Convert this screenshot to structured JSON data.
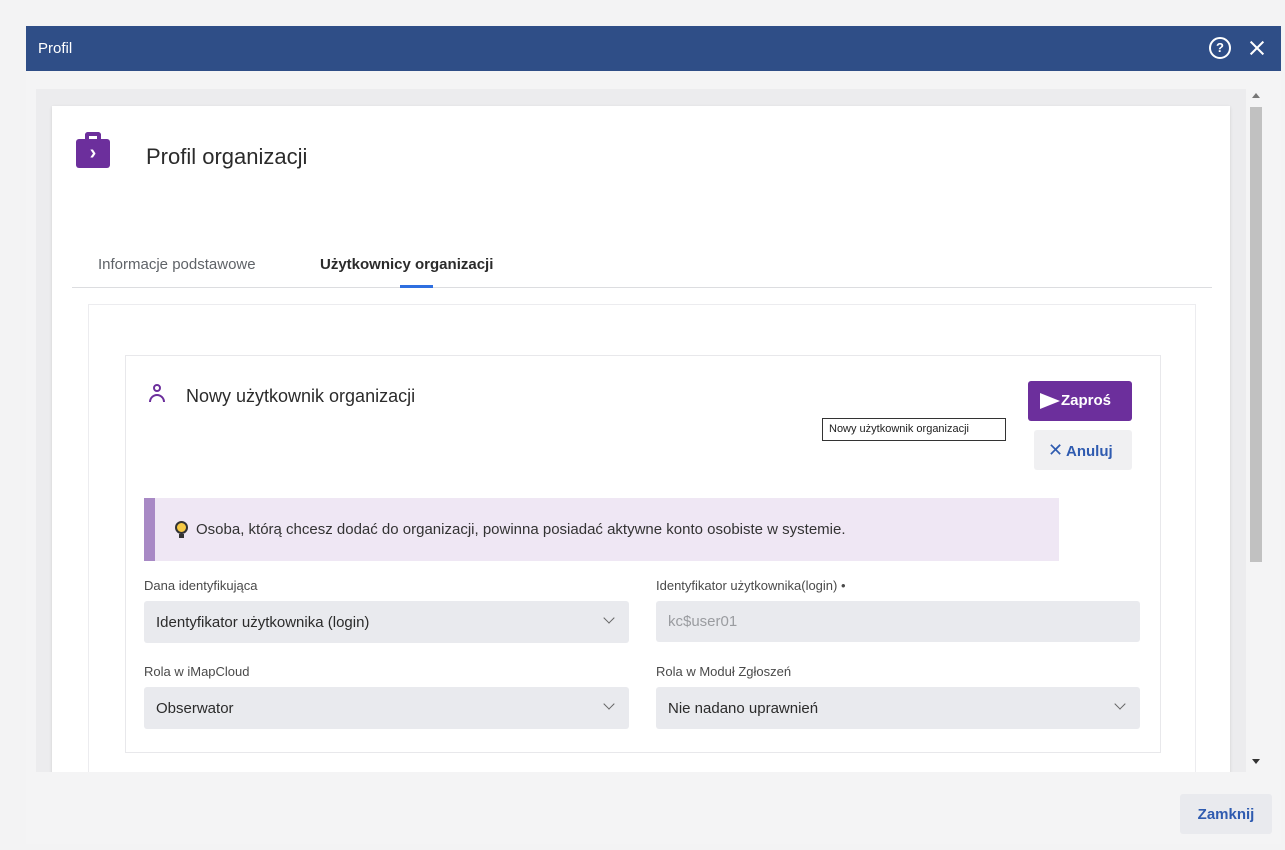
{
  "window": {
    "title": "Profil"
  },
  "card": {
    "title": "Profil organizacji"
  },
  "tabs": [
    {
      "label": "Informacje podstawowe",
      "active": false
    },
    {
      "label": "Użytkownicy organizacji",
      "active": true
    }
  ],
  "section": {
    "title": "Nowy użytkownik organizacji",
    "invite_label": "Zaproś",
    "cancel_label": "Anuluj",
    "tooltip": "Nowy użytkownik organizacji"
  },
  "notice": {
    "text": "Osoba, którą chcesz dodać do organizacji, powinna posiadać aktywne konto osobiste w systemie."
  },
  "form": {
    "identifier_type": {
      "label": "Dana identyfikująca",
      "value": "Identyfikator użytkownika (login)"
    },
    "login": {
      "label": "Identyfikator użytkownika(login) •",
      "value": "kc$user01"
    },
    "imapcloud_role": {
      "label": "Rola w iMapCloud",
      "value": "Obserwator"
    },
    "module_role": {
      "label": "Rola w Moduł Zgłoszeń",
      "value": "Nie nadano uprawnień"
    }
  },
  "footer": {
    "close_label": "Zamknij"
  },
  "colors": {
    "titlebar": "#2f4e87",
    "accent": "#6c2f9c",
    "link": "#2f5bb0",
    "notice_bg": "#efe7f4",
    "notice_border": "#a889c5"
  },
  "icons": [
    "help-icon",
    "close-icon",
    "briefcase-icon",
    "user-icon",
    "send-icon",
    "x-icon",
    "lightbulb-icon",
    "chevron-down-icon"
  ]
}
